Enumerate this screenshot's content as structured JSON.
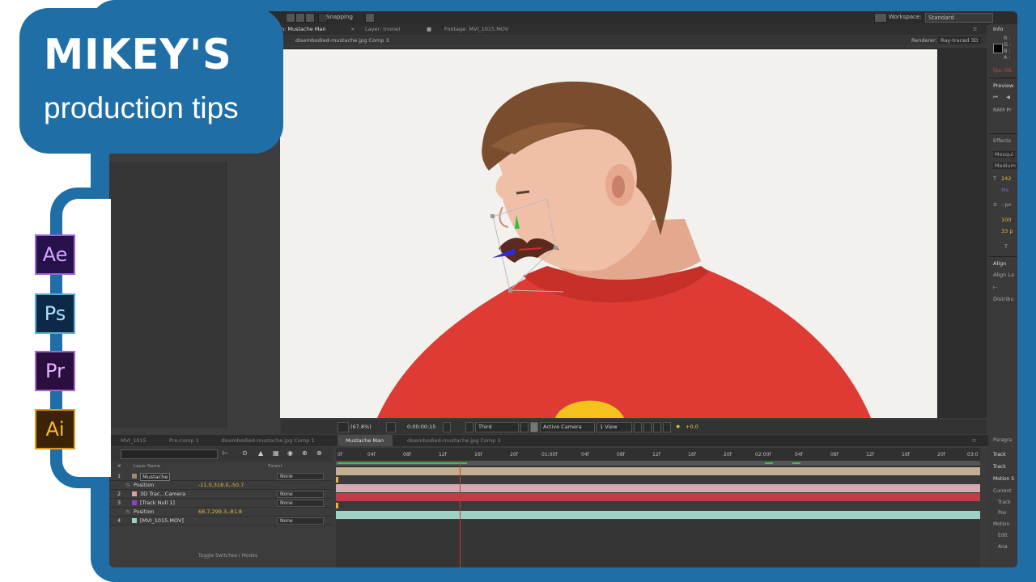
{
  "branding": {
    "title": "MIKEY'S",
    "subtitle": "production tips"
  },
  "apps": [
    {
      "abbr": "Ae",
      "text_color": "#d6a6ff",
      "bg": "#25124a",
      "border": "#9f63d9"
    },
    {
      "abbr": "Ps",
      "text_color": "#aee1ff",
      "bg": "#0c2a48",
      "border": "#5aa8d8"
    },
    {
      "abbr": "Pr",
      "text_color": "#e5b3ff",
      "bg": "#2a0f3e",
      "border": "#a366c9"
    },
    {
      "abbr": "Ai",
      "text_color": "#ffb82e",
      "bg": "#3a2306",
      "border": "#e39a1c"
    }
  ],
  "topbar": {
    "snapping": "Snapping",
    "workspace_label": "Workspace:",
    "workspace_value": "Standard"
  },
  "comp_panel": {
    "tab_comp": "n: Mustache Man",
    "tab_layer": "Layer: (none)",
    "tab_footage": "Footage: MVI_1015.MOV",
    "breadcrumb": "disembodied-mustache.jpg Comp 3",
    "renderer_label": "Renderer:",
    "renderer_value": "Ray-traced 3D"
  },
  "viewer_bar": {
    "zoom": "(67.8%)",
    "timecode": "0:00:00:15",
    "view_layout": "Third",
    "camera": "Active Camera",
    "views": "1 View",
    "exposure": "+0.0"
  },
  "right_panel": {
    "info": "Info",
    "preview": "Preview",
    "effects": "Effects",
    "align": "Align",
    "align_to": "Align La",
    "distribute": "Distribu",
    "ram": "RAM Pr",
    "fps": "fps: 06.",
    "info_r": "R :",
    "info_g": "G :",
    "info_b": "B :",
    "info_a": "A :",
    "char_font": "Mesqui",
    "char_style": "Medium",
    "char_size": "242",
    "char_auto": "Me",
    "char_px": "- px",
    "char_scale": "100",
    "char_base": "33 p",
    "paragraph": "Paragra",
    "track": "Track",
    "track2": "Track",
    "motion": "Motion S",
    "current": "Current",
    "track3": "Track",
    "position": "Pos",
    "motion2": "Motion",
    "edit": "Edit",
    "ana": "Ana"
  },
  "timeline": {
    "tabs": [
      "MVI_1015",
      "Pre-comp 1",
      "disembodied-mustache.jpg Comp 1",
      "Mustache Man",
      "disembodied-mustache.jpg Comp 3"
    ],
    "active_tab": "Mustache Man",
    "header": {
      "num": "#",
      "layer_name": "Layer Name",
      "parent": "Parent"
    },
    "layers": [
      {
        "num": "1",
        "name": "Mustache",
        "parent": "None",
        "color": "#a28a6e"
      },
      {
        "num": "",
        "name": "Position",
        "parent": "",
        "value": "-11.0,318.0,-50.7",
        "color": ""
      },
      {
        "num": "2",
        "name": "3D Trac...Camera",
        "parent": "None",
        "color": "#d9a0a8"
      },
      {
        "num": "3",
        "name": "[Track Null 1]",
        "parent": "None",
        "color": "#8a45c8"
      },
      {
        "num": "",
        "name": "Position",
        "parent": "",
        "value": "68.7,299.3,-81.8",
        "color": ""
      },
      {
        "num": "4",
        "name": "[MVI_1015.MOV]",
        "parent": "None",
        "color": "#9ed1c6"
      }
    ],
    "ruler_ticks": [
      "0f",
      "04f",
      "08f",
      "12f",
      "16f",
      "20f",
      "01:00f",
      "04f",
      "08f",
      "12f",
      "16f",
      "20f",
      "02:00f",
      "04f",
      "08f",
      "12f",
      "16f",
      "20f",
      "03:0"
    ],
    "bottom_text": "Toggle Switches / Modes"
  }
}
